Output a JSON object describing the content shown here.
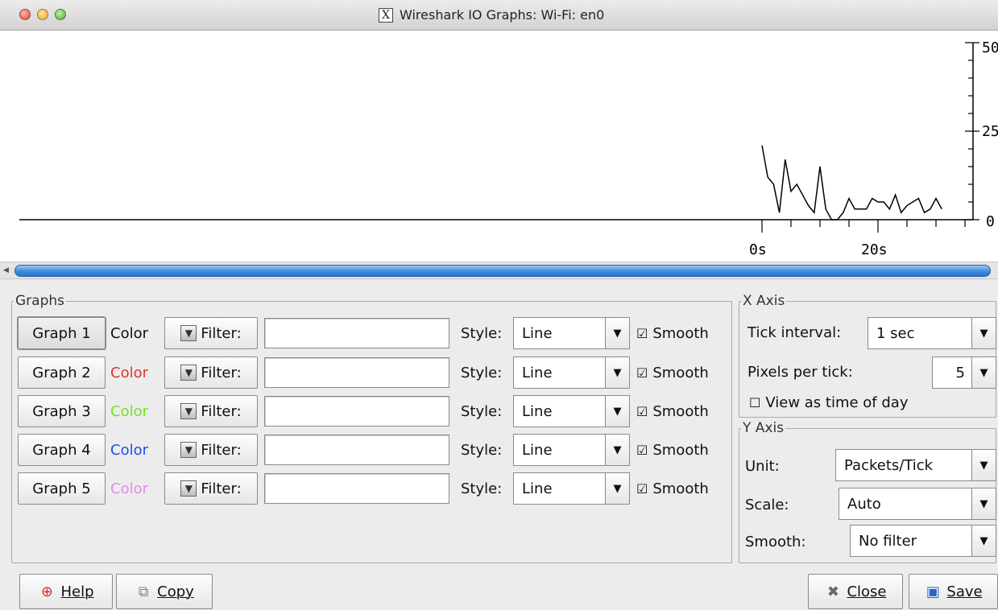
{
  "window": {
    "title": "Wireshark IO Graphs: Wi-Fi: en0"
  },
  "graph": {
    "y_tick_labels": [
      "50",
      "25",
      "0"
    ],
    "x_tick_labels": [
      "0s",
      "20s"
    ],
    "line_color": "#000000"
  },
  "chart_data": {
    "type": "line",
    "x": [
      0,
      1,
      2,
      3,
      4,
      5,
      6,
      7,
      8,
      9,
      10,
      11,
      12,
      13,
      14,
      15,
      16,
      17,
      18,
      19,
      20,
      21,
      22,
      23,
      24,
      25,
      26,
      27,
      28,
      29,
      30,
      31
    ],
    "series": [
      {
        "values": [
          21,
          12,
          10,
          2,
          17,
          8,
          10,
          7,
          4,
          2,
          15,
          3,
          0,
          0,
          2,
          6,
          3,
          3,
          3,
          6,
          5,
          5,
          3,
          7,
          2,
          4,
          5,
          6,
          2,
          3,
          6,
          3
        ]
      }
    ],
    "ylim": [
      0,
      50
    ],
    "xlabel": "",
    "ylabel": ""
  },
  "graphs_panel": {
    "legend": "Graphs",
    "rows": [
      {
        "button": "Graph 1",
        "color_label": "Color",
        "color": "#111111",
        "filter_label": "Filter:",
        "filter_value": "",
        "style_label": "Style:",
        "style_value": "Line",
        "smooth_label": "Smooth",
        "smooth_checked": true
      },
      {
        "button": "Graph 2",
        "color_label": "Color",
        "color": "#e0352c",
        "filter_label": "Filter:",
        "filter_value": "",
        "style_label": "Style:",
        "style_value": "Line",
        "smooth_label": "Smooth",
        "smooth_checked": true
      },
      {
        "button": "Graph 3",
        "color_label": "Color",
        "color": "#6fe61a",
        "filter_label": "Filter:",
        "filter_value": "",
        "style_label": "Style:",
        "style_value": "Line",
        "smooth_label": "Smooth",
        "smooth_checked": true
      },
      {
        "button": "Graph 4",
        "color_label": "Color",
        "color": "#1f4fe8",
        "filter_label": "Filter:",
        "filter_value": "",
        "style_label": "Style:",
        "style_value": "Line",
        "smooth_label": "Smooth",
        "smooth_checked": true
      },
      {
        "button": "Graph 5",
        "color_label": "Color",
        "color": "#e58aec",
        "filter_label": "Filter:",
        "filter_value": "",
        "style_label": "Style:",
        "style_value": "Line",
        "smooth_label": "Smooth",
        "smooth_checked": true
      }
    ]
  },
  "x_axis": {
    "legend": "X Axis",
    "tick_interval_label": "Tick interval:",
    "tick_interval_value": "1 sec",
    "pixels_per_tick_label": "Pixels per tick:",
    "pixels_per_tick_value": "5",
    "view_time_of_day_label": "View as time of day",
    "view_time_of_day_checked": false
  },
  "y_axis": {
    "legend": "Y Axis",
    "unit_label": "Unit:",
    "unit_value": "Packets/Tick",
    "scale_label": "Scale:",
    "scale_value": "Auto",
    "smooth_label": "Smooth:",
    "smooth_value": "No filter"
  },
  "footer": {
    "help_label": "Help",
    "copy_label": "Copy",
    "close_label": "Close",
    "save_label": "Save"
  }
}
